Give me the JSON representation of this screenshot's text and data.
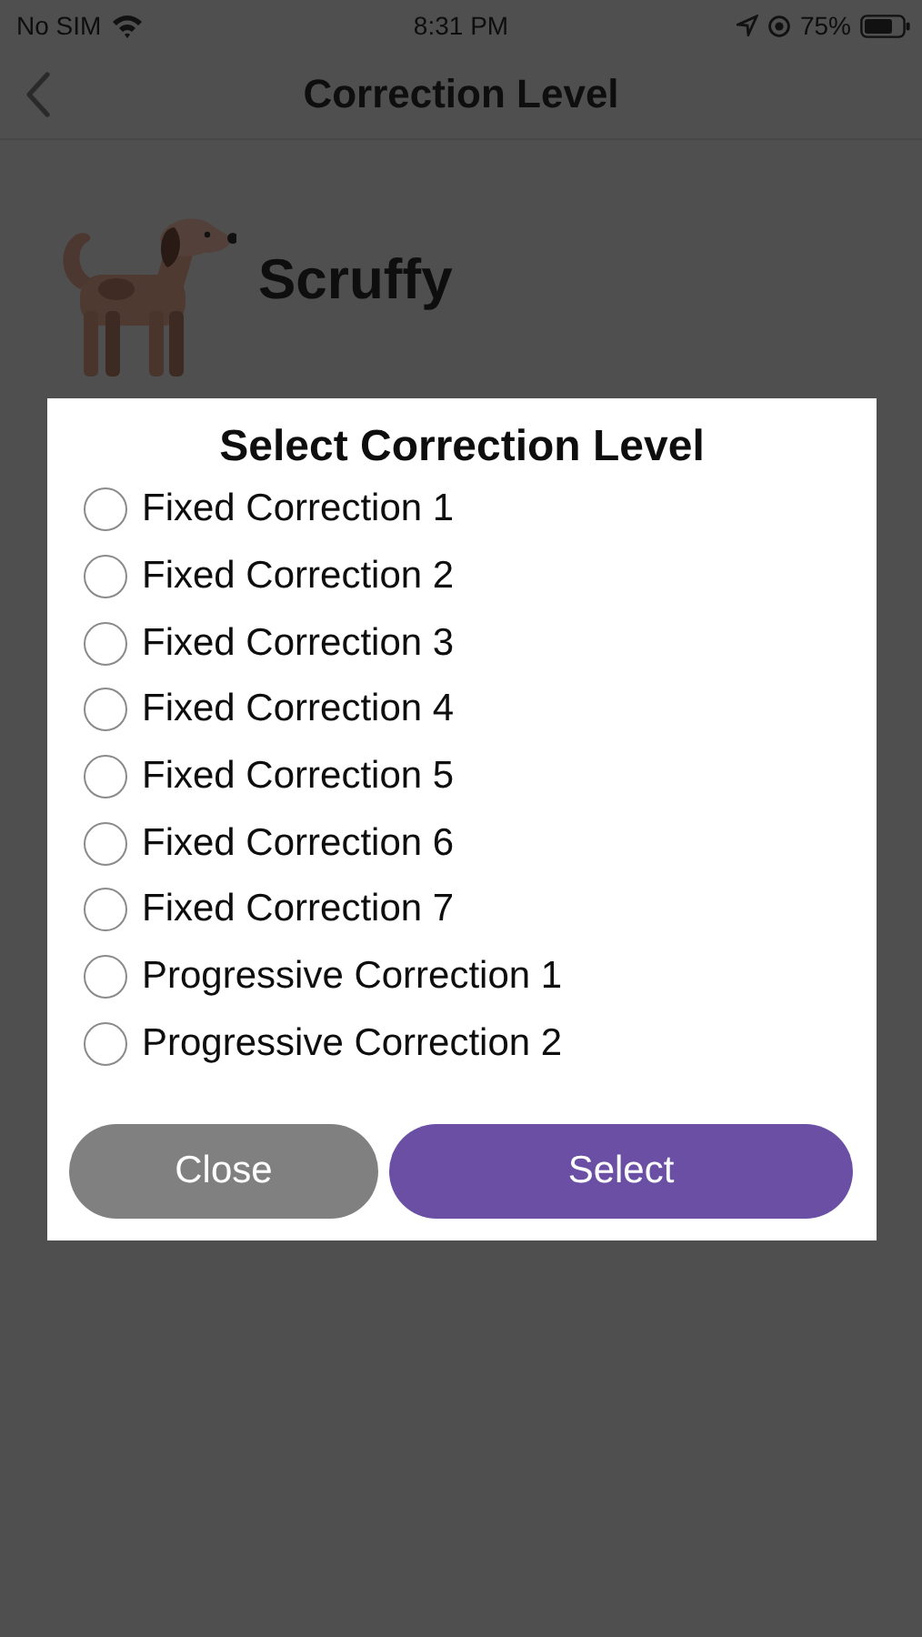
{
  "status_bar": {
    "carrier": "No SIM",
    "time": "8:31 PM",
    "battery": "75%"
  },
  "nav": {
    "title": "Correction Level"
  },
  "pet": {
    "name": "Scruffy"
  },
  "dialog": {
    "title": "Select Correction Level",
    "options": [
      {
        "label": "Fixed Correction 1",
        "selected": false
      },
      {
        "label": "Fixed Correction 2",
        "selected": false
      },
      {
        "label": "Fixed Correction 3",
        "selected": false
      },
      {
        "label": "Fixed Correction 4",
        "selected": false
      },
      {
        "label": "Fixed Correction 5",
        "selected": false
      },
      {
        "label": "Fixed Correction 6",
        "selected": false
      },
      {
        "label": "Fixed Correction 7",
        "selected": false
      },
      {
        "label": "Progressive Correction 1",
        "selected": false
      },
      {
        "label": "Progressive Correction 2",
        "selected": false
      }
    ],
    "buttons": [
      {
        "label": "Close",
        "kind": "secondary"
      },
      {
        "label": "Select",
        "kind": "primary"
      }
    ]
  }
}
